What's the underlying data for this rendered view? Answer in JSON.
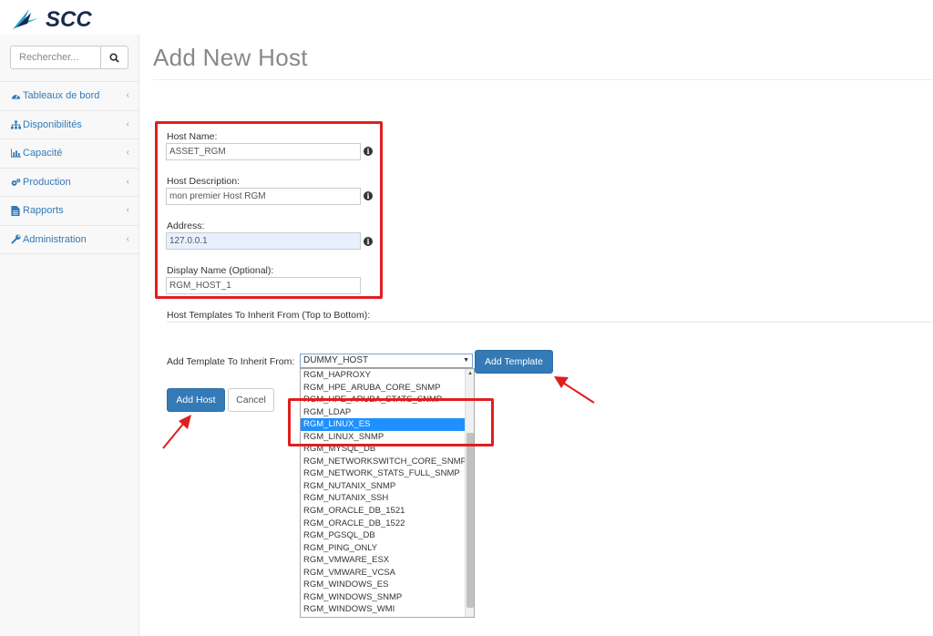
{
  "brand": {
    "name": "SCC",
    "color": "#1a2a4a",
    "accent": "#2a9fd6"
  },
  "sidebar": {
    "search_placeholder": "Rechercher...",
    "search_icon": "search-icon",
    "items": [
      {
        "label": "Tableaux de bord",
        "icon": "dashboard-icon"
      },
      {
        "label": "Disponibilités",
        "icon": "sitemap-icon"
      },
      {
        "label": "Capacité",
        "icon": "bar-chart-icon"
      },
      {
        "label": "Production",
        "icon": "cogs-icon"
      },
      {
        "label": "Rapports",
        "icon": "file-icon"
      },
      {
        "label": "Administration",
        "icon": "wrench-icon"
      }
    ]
  },
  "page": {
    "title": "Add New Host"
  },
  "form": {
    "host_name": {
      "label": "Host Name:",
      "value": "ASSET_RGM"
    },
    "host_description": {
      "label": "Host Description:",
      "value": "mon premier Host RGM"
    },
    "address": {
      "label": "Address:",
      "value": "127.0.0.1"
    },
    "display_name": {
      "label": "Display Name (Optional):",
      "value": "RGM_HOST_1"
    },
    "templates_section_label": "Host Templates To Inherit From (Top to Bottom):",
    "add_template_label": "Add Template To Inherit From:",
    "template_select_value": "DUMMY_HOST",
    "add_template_button": "Add Template",
    "add_host_button": "Add Host",
    "cancel_button": "Cancel"
  },
  "template_options": [
    "RGM_HAPROXY",
    "RGM_HPE_ARUBA_CORE_SNMP",
    "RGM_HPE_ARUBA_STATS_SNMP",
    "RGM_LDAP",
    "RGM_LINUX_ES",
    "RGM_LINUX_SNMP",
    "RGM_MYSQL_DB",
    "RGM_NETWORKSWITCH_CORE_SNMP",
    "RGM_NETWORK_STATS_FULL_SNMP",
    "RGM_NUTANIX_SNMP",
    "RGM_NUTANIX_SSH",
    "RGM_ORACLE_DB_1521",
    "RGM_ORACLE_DB_1522",
    "RGM_PGSQL_DB",
    "RGM_PING_ONLY",
    "RGM_VMWARE_ESX",
    "RGM_VMWARE_VCSA",
    "RGM_WINDOWS_ES",
    "RGM_WINDOWS_SNMP",
    "RGM_WINDOWS_WMI"
  ],
  "selected_option": "RGM_LINUX_ES",
  "colors": {
    "primary": "#337ab7",
    "annotation": "#e01e1e",
    "selection": "#1e90ff"
  }
}
